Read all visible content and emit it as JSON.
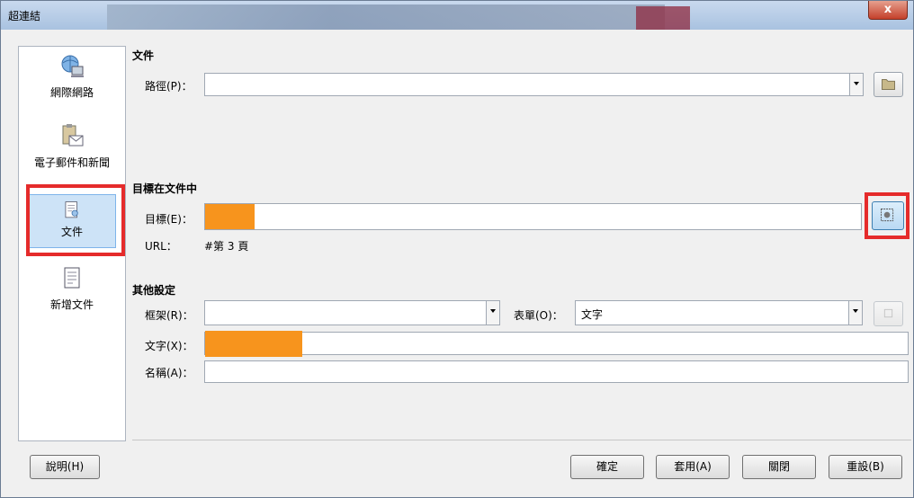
{
  "window": {
    "title": "超連結",
    "close_label": "x"
  },
  "sidebar": {
    "items": [
      {
        "label": "網際網路",
        "icon": "globe-computer-icon"
      },
      {
        "label": "電子郵件和新聞",
        "icon": "mail-clipboard-icon"
      },
      {
        "label": "文件",
        "icon": "document-icon",
        "selected": true
      },
      {
        "label": "新增文件",
        "icon": "new-document-icon"
      }
    ]
  },
  "document": {
    "section_title": "文件",
    "path_label": "路徑(P)：",
    "path_value": ""
  },
  "target": {
    "section_title": "目標在文件中",
    "target_label": "目標(E)：",
    "target_value": "",
    "url_label": "URL：",
    "url_value": "#第 3 頁"
  },
  "other": {
    "section_title": "其他設定",
    "frame_label": "框架(R)：",
    "frame_value": "",
    "form_label": "表單(O)：",
    "form_value": "文字",
    "text_label": "文字(X)：",
    "text_value": "",
    "name_label": "名稱(A)：",
    "name_value": ""
  },
  "buttons": {
    "help": "說明(H)",
    "ok": "確定",
    "apply": "套用(A)",
    "close": "關閉",
    "reset": "重設(B)"
  },
  "colors": {
    "highlight": "#e52b2b",
    "redaction": "#f7941d"
  }
}
